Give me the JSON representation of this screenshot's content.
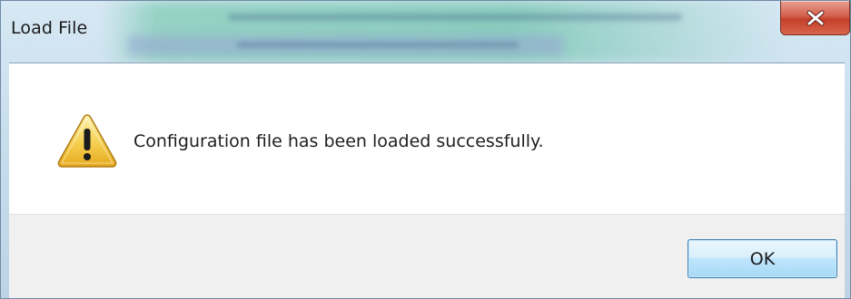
{
  "window": {
    "title": "Load File"
  },
  "dialog": {
    "icon": "warning-icon",
    "message": "Configuration file has been loaded successfully.",
    "ok_label": "OK"
  },
  "colors": {
    "close_button": "#d4604c",
    "warning_fill": "#f2c94c",
    "ok_border": "#3c7fb1"
  }
}
